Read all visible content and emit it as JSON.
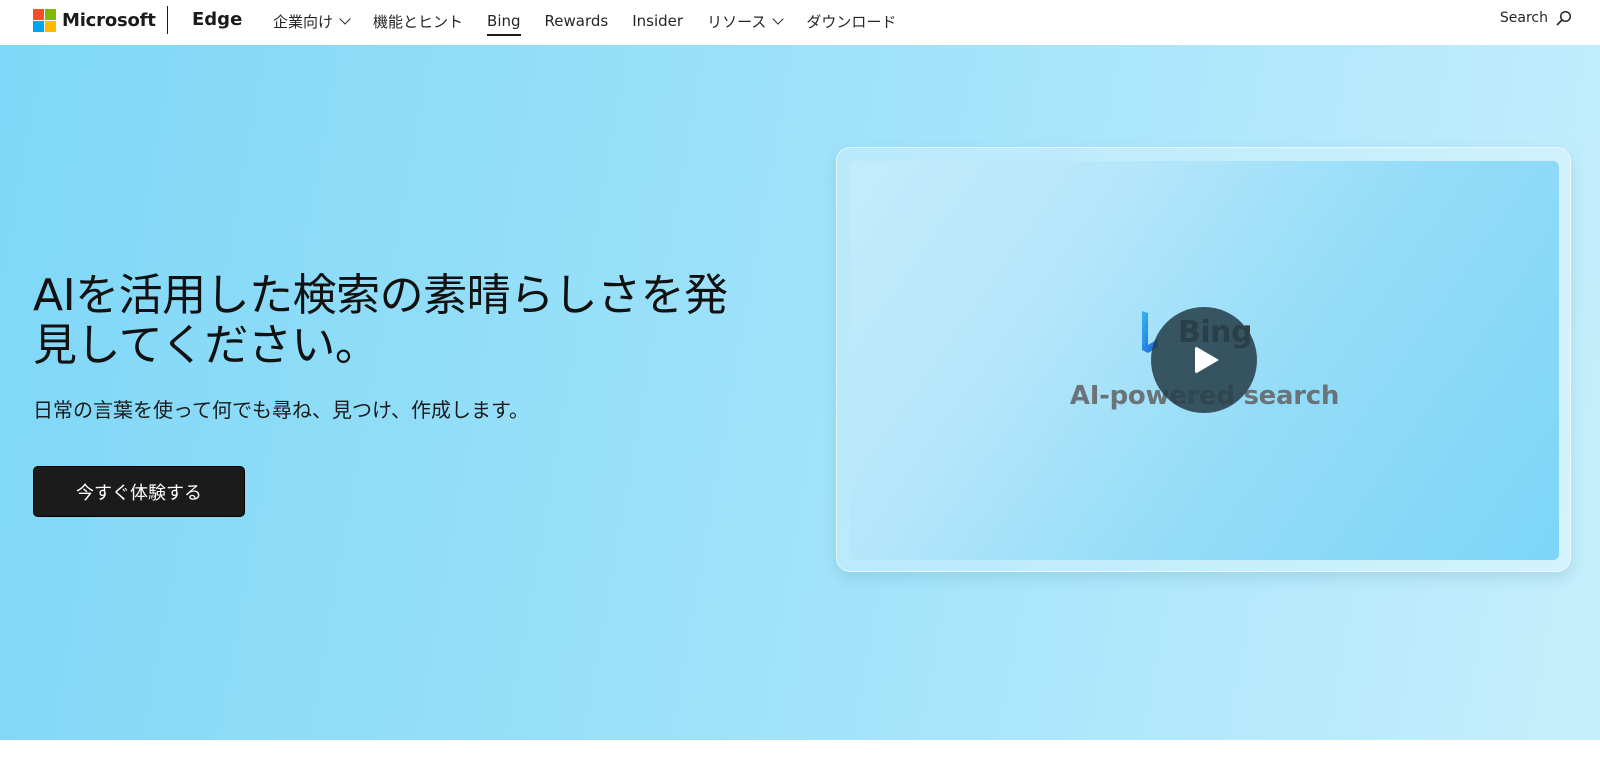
{
  "header": {
    "brand": "Microsoft",
    "product": "Edge",
    "nav": [
      {
        "label": "企業向け",
        "dropdown": true
      },
      {
        "label": "機能とヒント",
        "dropdown": false
      },
      {
        "label": "Bing",
        "dropdown": false,
        "active": true
      },
      {
        "label": "Rewards",
        "dropdown": false
      },
      {
        "label": "Insider",
        "dropdown": false
      },
      {
        "label": "リソース",
        "dropdown": true
      },
      {
        "label": "ダウンロード",
        "dropdown": false
      }
    ],
    "search_label": "Search",
    "logo_colors": [
      "#f25022",
      "#7fba00",
      "#00a4ef",
      "#ffb900"
    ]
  },
  "hero": {
    "title": "AIを活用した検索の素晴らしさを発見してください。",
    "subtitle": "日常の言葉を使って何でも尋ね、見つけ、作成します。",
    "cta_label": "今すぐ体験する"
  },
  "video": {
    "brand_word": "Bing",
    "caption": "AI-powered search",
    "play_icon": "play-icon"
  }
}
